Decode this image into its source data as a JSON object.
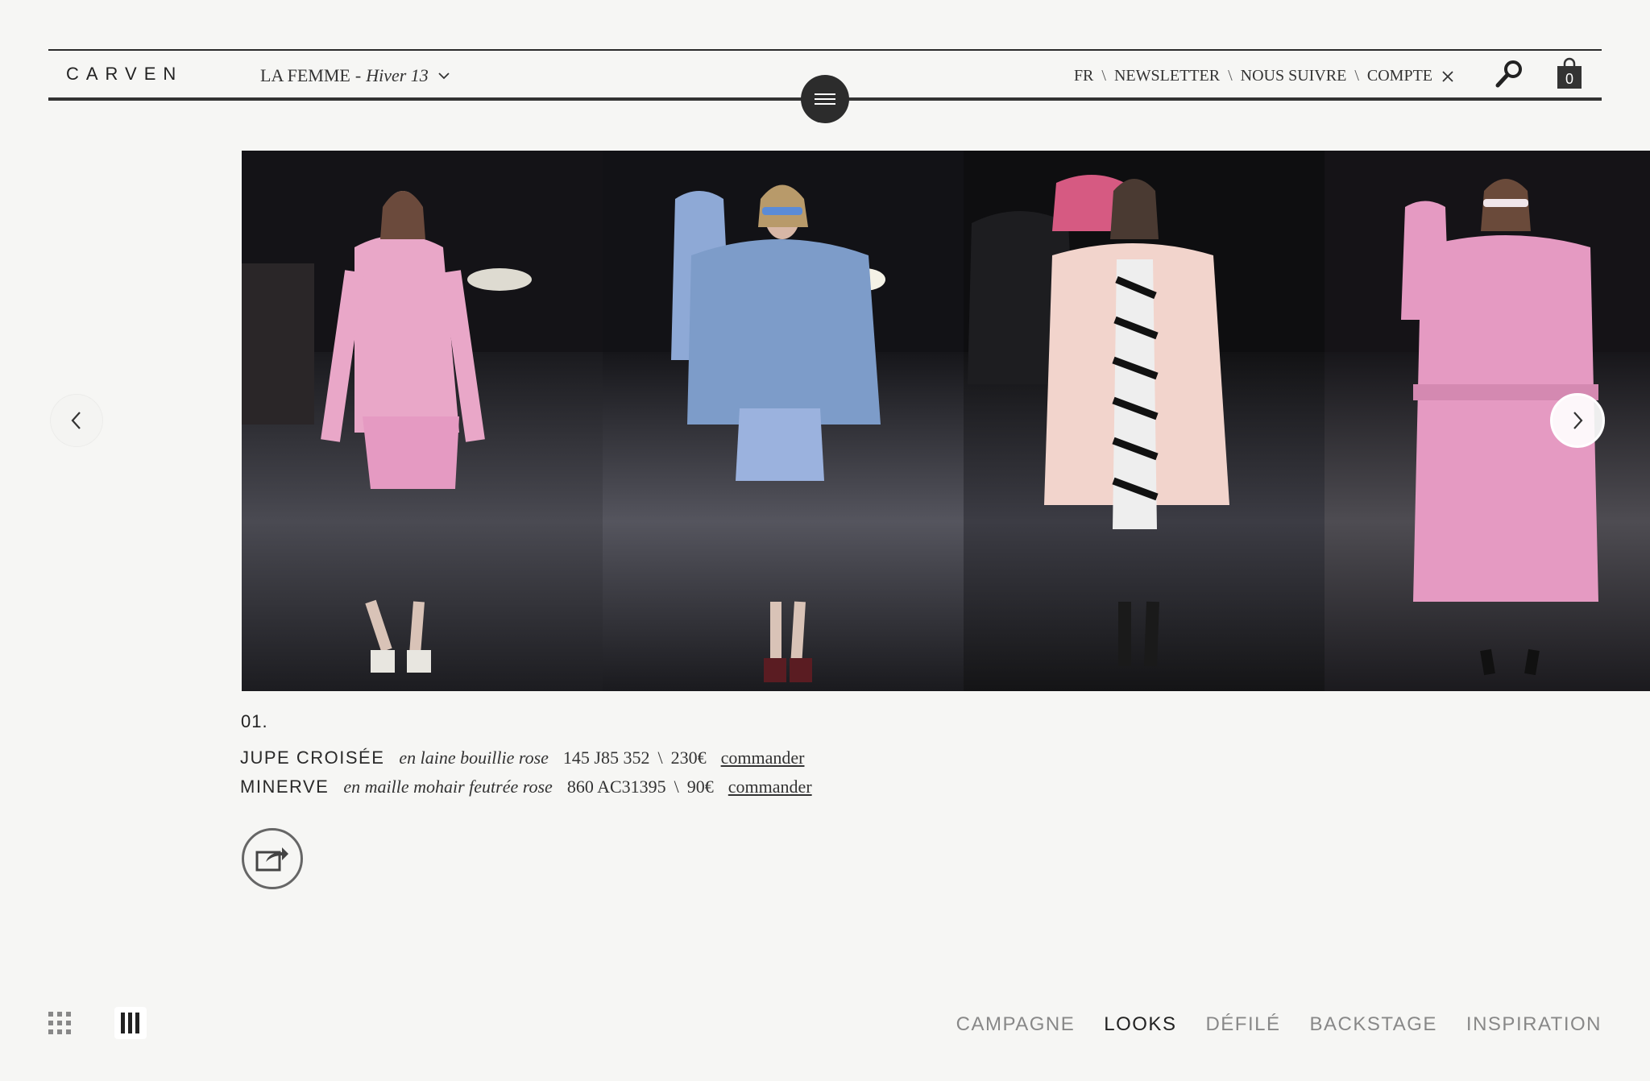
{
  "header": {
    "logo": "CARVEN",
    "collection": {
      "line": "LA FEMME",
      "separator": "-",
      "season": "Hiver 13"
    },
    "nav": [
      {
        "label": "FR"
      },
      {
        "label": "NEWSLETTER"
      },
      {
        "label": "NOUS SUIVRE"
      },
      {
        "label": "COMPTE"
      }
    ],
    "nav_separator": "\\",
    "bag_count": "0"
  },
  "gallery": {
    "looks": [
      {
        "coat_color": "#e9a7c8",
        "bg": "#141317"
      },
      {
        "coat_color": "#7d9cc9",
        "bg": "#121216"
      },
      {
        "coat_color": "#f2d4cc",
        "bg": "#0e0e10"
      },
      {
        "coat_color": "#e59ac2",
        "bg": "#151317"
      }
    ]
  },
  "look_detail": {
    "number": "01.",
    "products": [
      {
        "name": "JUPE CROISÉE",
        "description": "en laine bouillie rose",
        "ref": "145 J85 352",
        "slash": "\\",
        "price": "230€",
        "link": "commander"
      },
      {
        "name": "MINERVE",
        "description": "en maille mohair feutrée rose",
        "ref": "860 AC31395",
        "slash": "\\",
        "price": "90€",
        "link": "commander"
      }
    ]
  },
  "bottom_nav": {
    "tabs": [
      {
        "label": "CAMPAGNE",
        "active": false
      },
      {
        "label": "LOOKS",
        "active": true
      },
      {
        "label": "DÉFILÉ",
        "active": false
      },
      {
        "label": "BACKSTAGE",
        "active": false
      },
      {
        "label": "INSPIRATION",
        "active": false
      }
    ]
  },
  "icons": {
    "menu": "hamburger-icon",
    "search": "search-icon",
    "bag": "shopping-bag-icon",
    "close": "close-icon",
    "share": "share-icon",
    "grid": "grid-view-icon",
    "columns": "column-view-icon",
    "prev": "chevron-left-icon",
    "next": "chevron-right-icon"
  }
}
